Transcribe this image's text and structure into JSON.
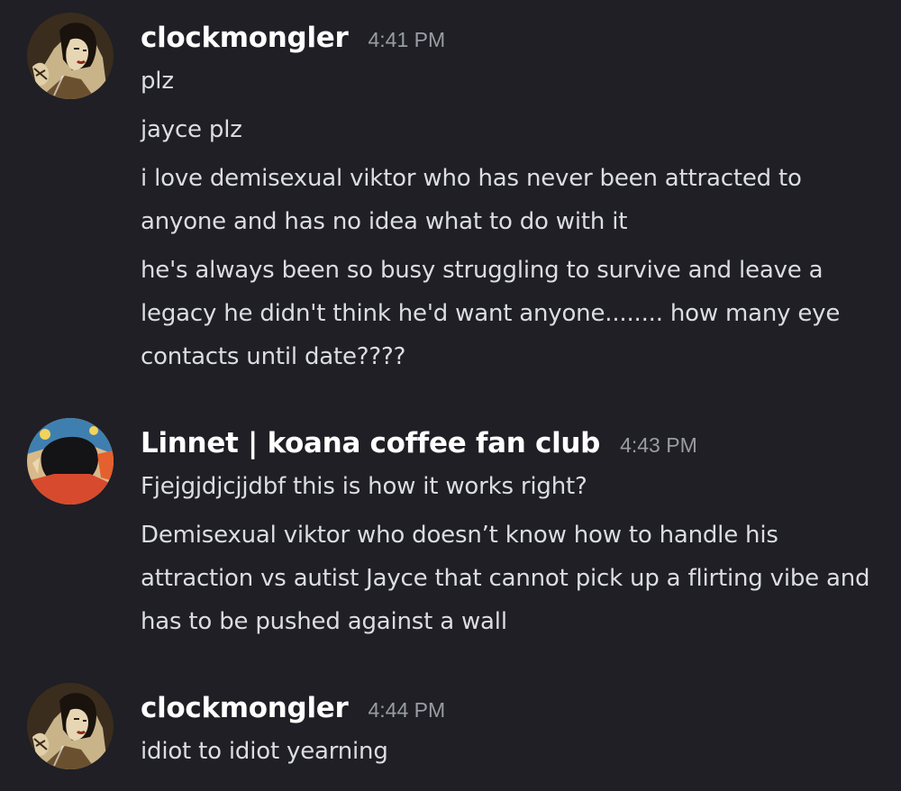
{
  "messages": [
    {
      "username": "clockmongler",
      "time": "4:41 PM",
      "lines": [
        "plz",
        "jayce plz",
        "i love demisexual viktor who has never been attracted to anyone and has no idea what to do with it",
        "he's always been so busy struggling to survive and leave a legacy he didn't think he'd want anyone........ how many eye contacts until date????"
      ]
    },
    {
      "username": "Linnet | koana coffee fan club",
      "time": "4:43 PM",
      "lines": [
        "Fjejgjdjcjjdbf this is how it works right?",
        "Demisexual viktor who doesn’t know how to handle his attraction vs autist Jayce that cannot pick up a flirting vibe and has to be pushed against a wall"
      ]
    },
    {
      "username": "clockmongler",
      "time": "4:44 PM",
      "lines": [
        "idiot to idiot yearning"
      ]
    }
  ],
  "colors": {
    "background": "#1f1f25",
    "username": "#ffffff",
    "timestamp": "#9a9ca4",
    "message_text": "#dbdde1"
  }
}
